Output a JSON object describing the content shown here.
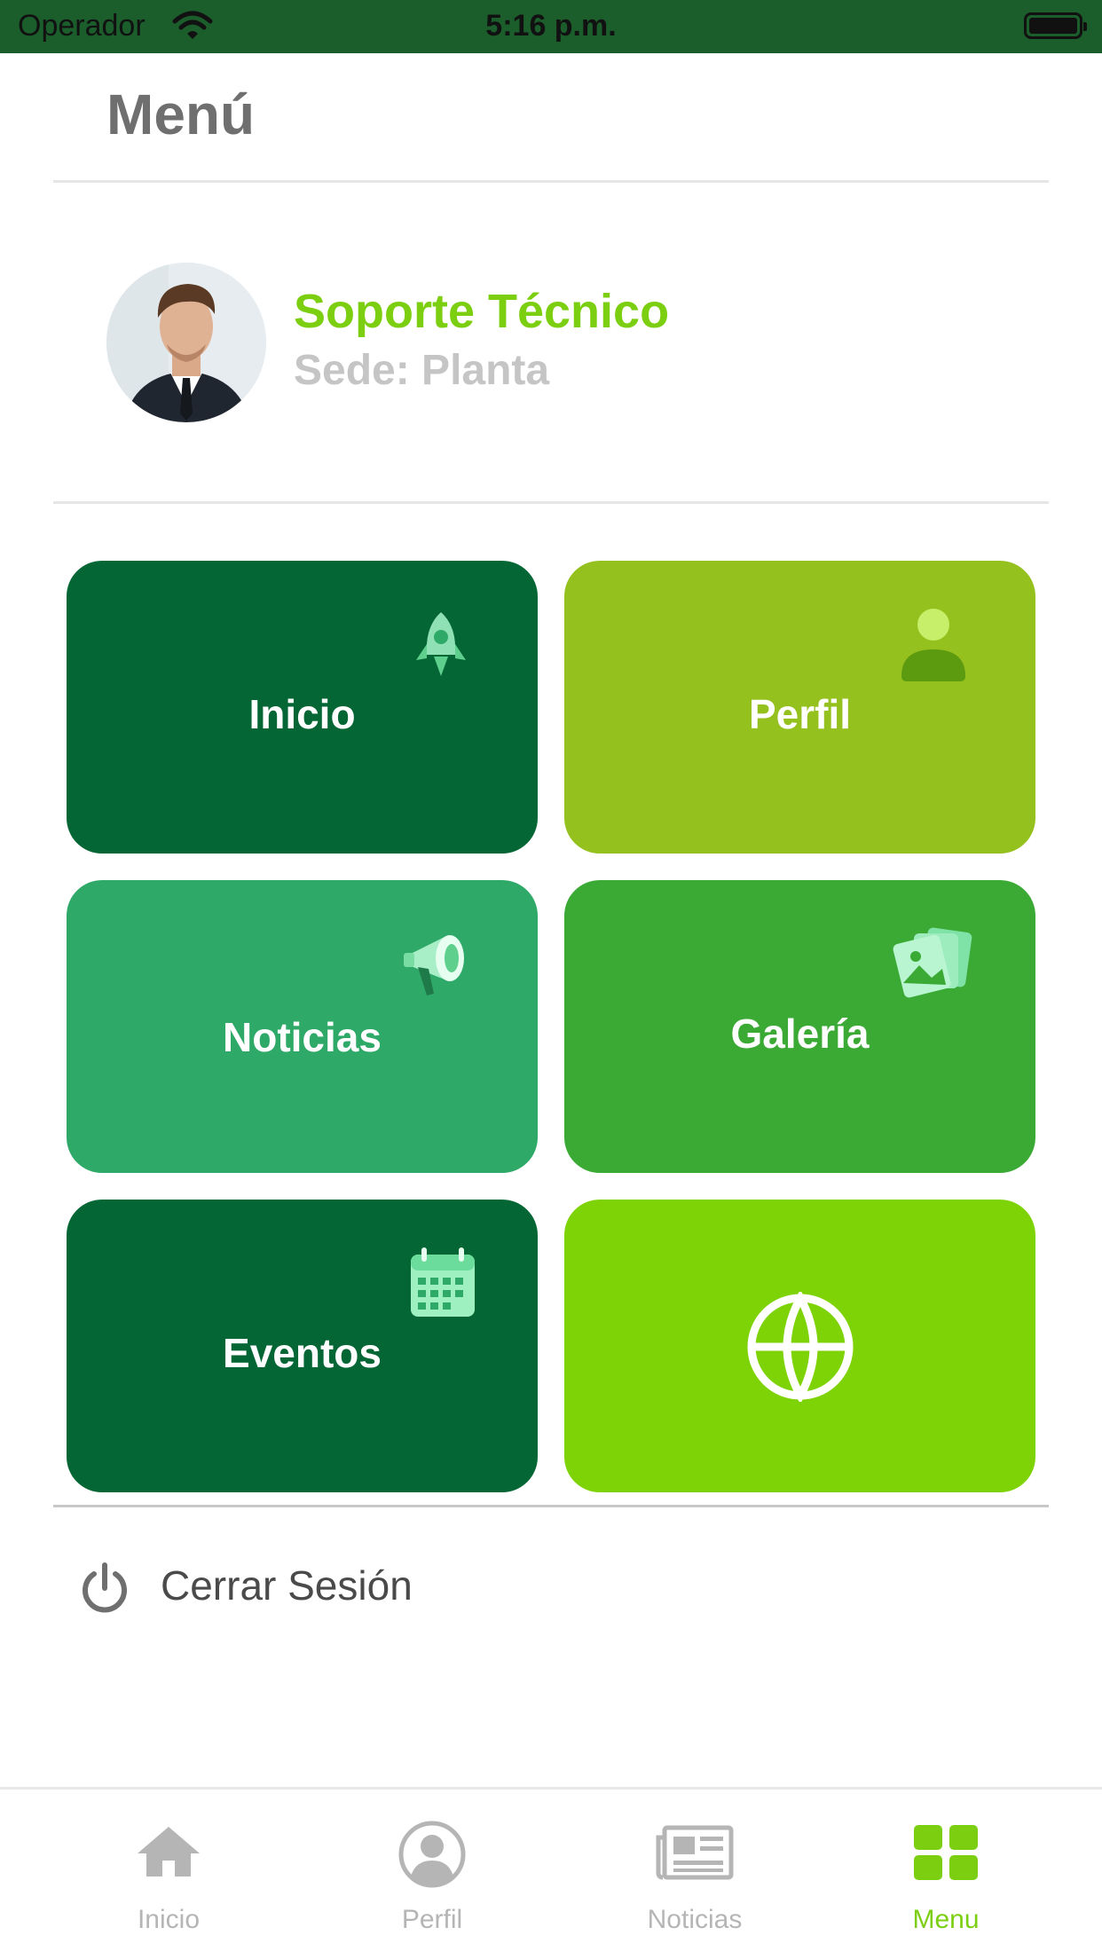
{
  "status_bar": {
    "carrier": "Operador",
    "time": "5:16 p.m."
  },
  "header": {
    "title": "Menú"
  },
  "user": {
    "name": "Soporte Técnico",
    "site": "Sede: Planta"
  },
  "tiles": [
    {
      "label": "Inicio",
      "icon": "rocket-icon",
      "color": "#046634"
    },
    {
      "label": "Perfil",
      "icon": "person-icon",
      "color": "#95c11f"
    },
    {
      "label": "Noticias",
      "icon": "megaphone-icon",
      "color": "#2ea967"
    },
    {
      "label": "Galería",
      "icon": "photos-icon",
      "color": "#3aaa35"
    },
    {
      "label": "Eventos",
      "icon": "calendar-icon",
      "color": "#046634"
    },
    {
      "label": "",
      "icon": "globe-icon",
      "color": "#7ed306"
    }
  ],
  "logout": {
    "label": "Cerrar Sesión",
    "icon": "power-icon"
  },
  "tabbar": {
    "items": [
      {
        "label": "Inicio",
        "icon": "home-icon",
        "active": false
      },
      {
        "label": "Perfil",
        "icon": "user-circle-icon",
        "active": false
      },
      {
        "label": "Noticias",
        "icon": "newspaper-icon",
        "active": false
      },
      {
        "label": "Menu",
        "icon": "grid-icon",
        "active": true
      }
    ],
    "active_color": "#7ccf10",
    "inactive_color": "#b5b5b5"
  }
}
